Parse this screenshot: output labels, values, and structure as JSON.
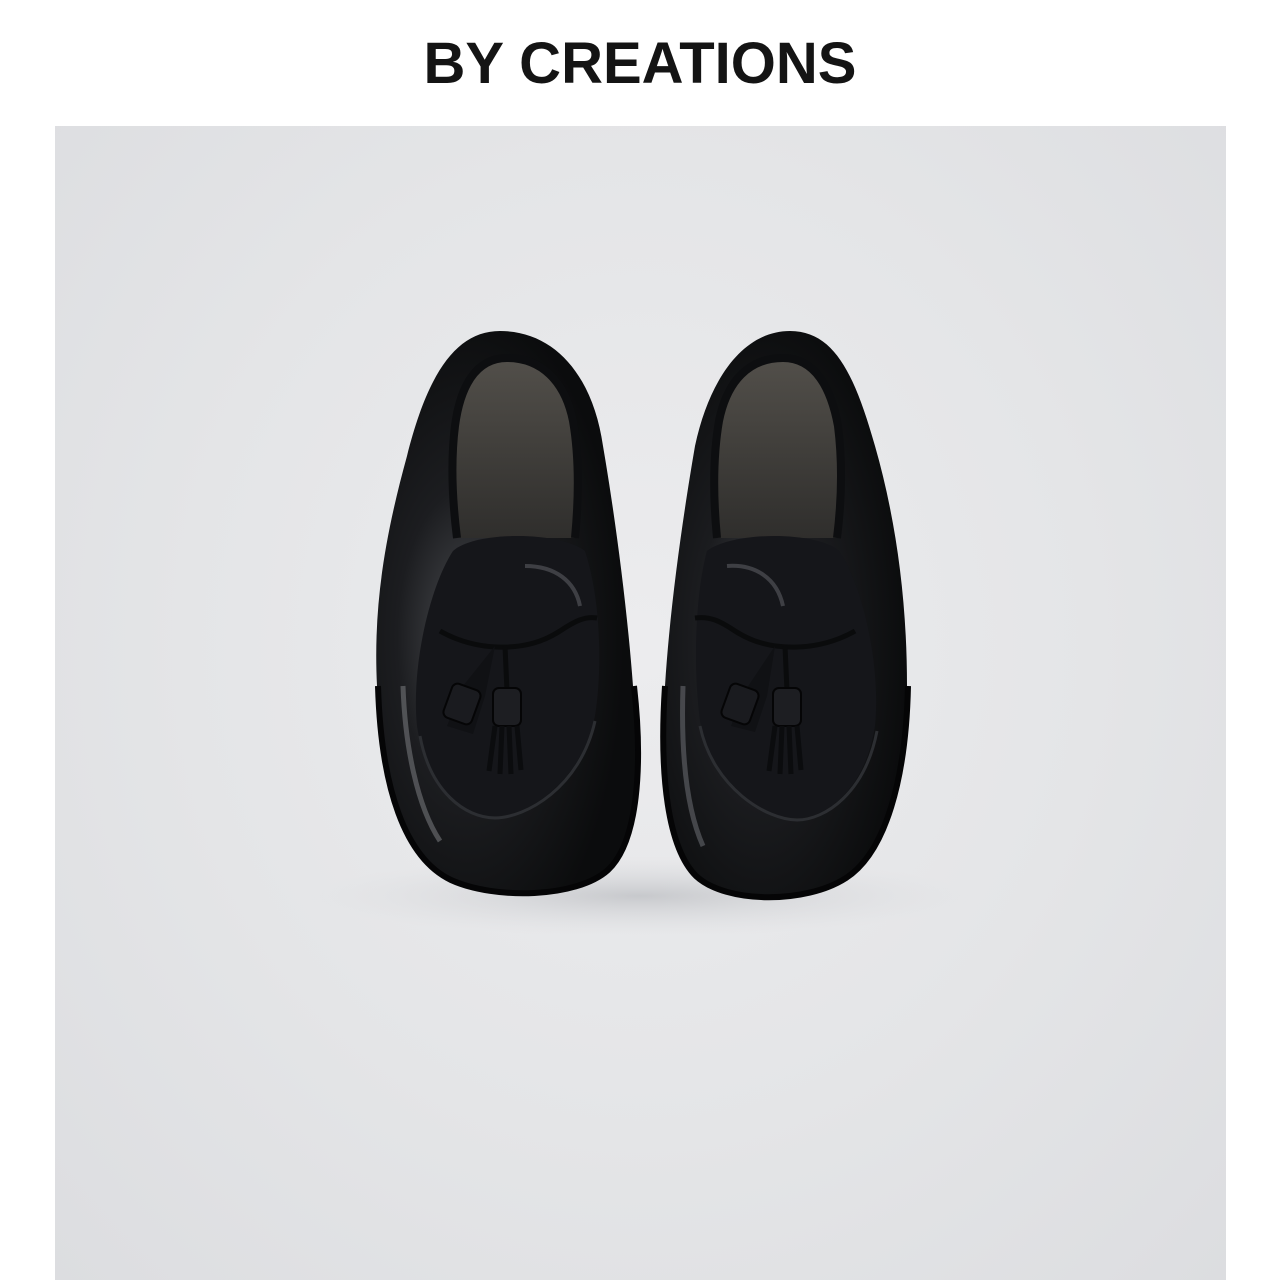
{
  "brand": {
    "name": "BY CREATIONS"
  },
  "photo": {
    "subject": "pair-of-black-leather-tassel-loafers",
    "colors": {
      "background": "#e4e5e7",
      "leather": "#111214",
      "leather_highlight": "#6a6c70",
      "lining": "#3b3a37"
    }
  }
}
